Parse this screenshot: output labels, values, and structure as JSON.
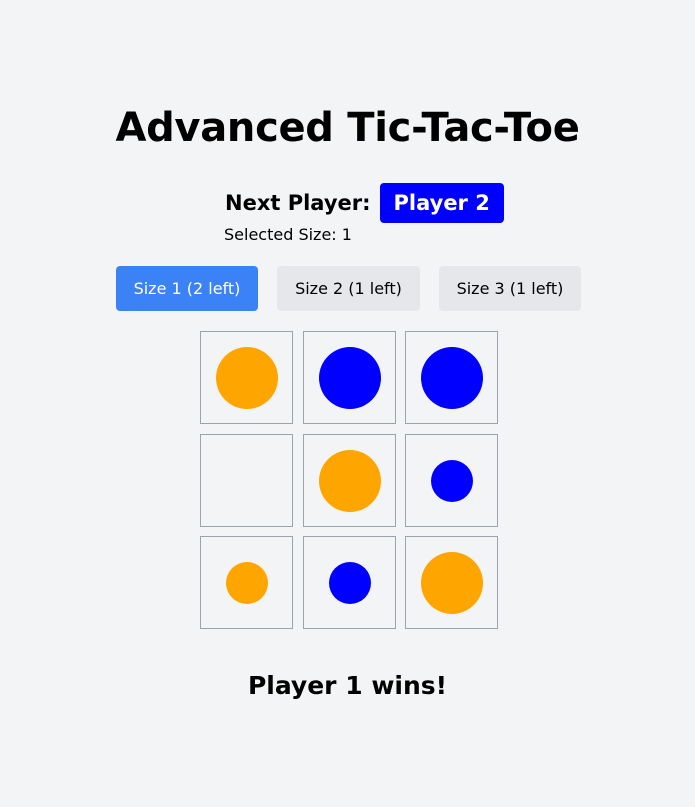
{
  "title": "Advanced Tic-Tac-Toe",
  "status": {
    "next_player_label": "Next Player:",
    "next_player": "Player 2",
    "next_player_color": "#0000ff",
    "selected_size_text": "Selected Size: 1"
  },
  "size_buttons": [
    {
      "label": "Size 1 (2 left)",
      "active": true
    },
    {
      "label": "Size 2 (1 left)",
      "active": false
    },
    {
      "label": "Size 3 (1 left)",
      "active": false
    }
  ],
  "colors": {
    "player1": "#ffa500",
    "player2": "#0000ff",
    "accent": "#3b82f6",
    "button_inactive": "#e5e7eb",
    "background": "#f3f4f6"
  },
  "board": [
    [
      {
        "player": 1,
        "size": 3
      },
      {
        "player": 2,
        "size": 3
      },
      {
        "player": 2,
        "size": 3
      }
    ],
    [
      null,
      {
        "player": 1,
        "size": 3
      },
      {
        "player": 2,
        "size": 2
      }
    ],
    [
      {
        "player": 1,
        "size": 2
      },
      {
        "player": 2,
        "size": 2
      },
      {
        "player": 1,
        "size": 3
      }
    ]
  ],
  "result": "Player 1 wins!"
}
